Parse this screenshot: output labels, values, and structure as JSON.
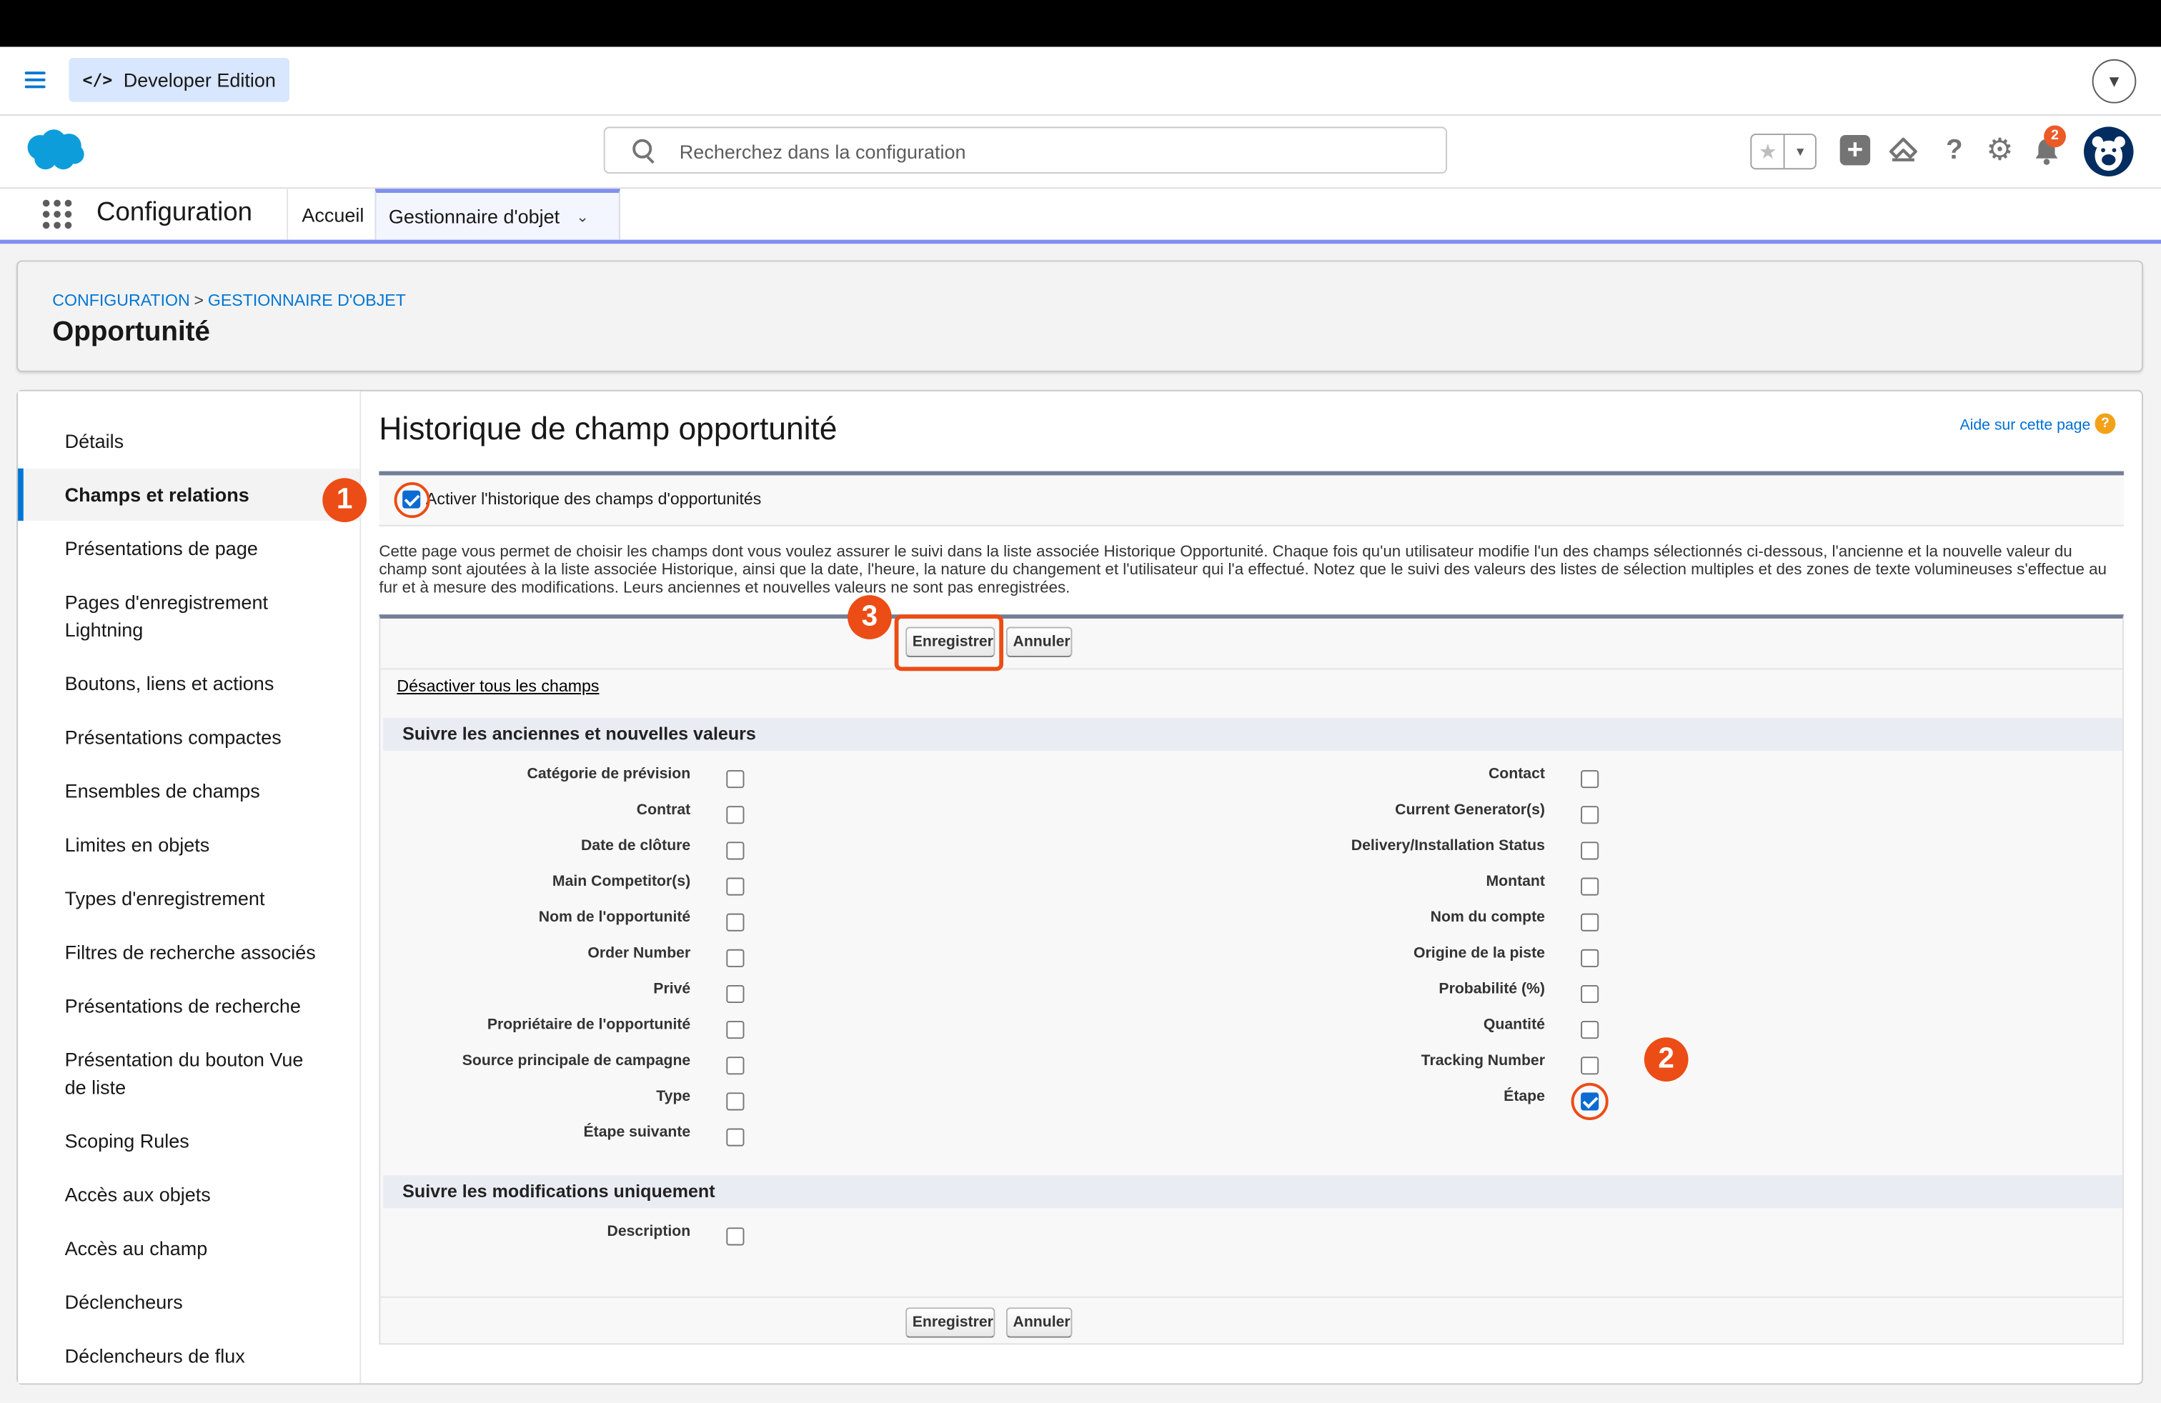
{
  "devbar": {
    "badge": "Developer Edition"
  },
  "header": {
    "search_placeholder": "Recherchez dans la configuration",
    "notification_count": "2"
  },
  "appnav": {
    "app_name": "Configuration",
    "tabs": [
      {
        "label": "Accueil"
      },
      {
        "label": "Gestionnaire d'objet"
      }
    ]
  },
  "page_header": {
    "breadcrumb": [
      "CONFIGURATION",
      "GESTIONNAIRE D'OBJET"
    ],
    "breadcrumb_sep": ">",
    "title": "Opportunité"
  },
  "sidebar": {
    "items": [
      {
        "label": "Détails"
      },
      {
        "label": "Champs et relations"
      },
      {
        "label": "Présentations de page"
      },
      {
        "label": "Pages d'enregistrement Lightning"
      },
      {
        "label": "Boutons, liens et actions"
      },
      {
        "label": "Présentations compactes"
      },
      {
        "label": "Ensembles de champs"
      },
      {
        "label": "Limites en objets"
      },
      {
        "label": "Types d'enregistrement"
      },
      {
        "label": "Filtres de recherche associés"
      },
      {
        "label": "Présentations de recherche"
      },
      {
        "label": "Présentation du bouton Vue de liste"
      },
      {
        "label": "Scoping Rules"
      },
      {
        "label": "Accès aux objets"
      },
      {
        "label": "Accès au champ"
      },
      {
        "label": "Déclencheurs"
      },
      {
        "label": "Déclencheurs de flux"
      }
    ]
  },
  "content": {
    "title": "Historique de champ opportunité",
    "help_link": "Aide sur cette page",
    "help_icon_glyph": "?",
    "enable_label": "Activer l'historique des champs d'opportunités",
    "description": "Cette page vous permet de choisir les champs dont vous voulez assurer le suivi dans la liste associée Historique Opportunité. Chaque fois qu'un utilisateur modifie l'un des champs sélectionnés ci-dessous, l'ancienne et la nouvelle valeur du champ sont ajoutées à la liste associée Historique, ainsi que la date, l'heure, la nature du changement et l'utilisateur qui l'a effectué. Notez que le suivi des valeurs des listes de sélection multiples et des zones de texte volumineuses s'effectue au fur et à mesure des modifications. Leurs anciennes et nouvelles valeurs ne sont pas enregistrées.",
    "save_label": "Enregistrer",
    "cancel_label": "Annuler",
    "disable_all_link": "Désactiver tous les champs",
    "section_track_values": "Suivre les anciennes et nouvelles valeurs",
    "section_track_changes": "Suivre les modifications uniquement",
    "left_fields": [
      {
        "label": "Catégorie de prévision",
        "checked": false
      },
      {
        "label": "Contrat",
        "checked": false
      },
      {
        "label": "Date de clôture",
        "checked": false
      },
      {
        "label": "Main Competitor(s)",
        "checked": false
      },
      {
        "label": "Nom de l'opportunité",
        "checked": false
      },
      {
        "label": "Order Number",
        "checked": false
      },
      {
        "label": "Privé",
        "checked": false
      },
      {
        "label": "Propriétaire de l'opportunité",
        "checked": false
      },
      {
        "label": "Source principale de campagne",
        "checked": false
      },
      {
        "label": "Type",
        "checked": false
      },
      {
        "label": "Étape suivante",
        "checked": false
      }
    ],
    "right_fields": [
      {
        "label": "Contact",
        "checked": false
      },
      {
        "label": "Current Generator(s)",
        "checked": false
      },
      {
        "label": "Delivery/Installation Status",
        "checked": false
      },
      {
        "label": "Montant",
        "checked": false
      },
      {
        "label": "Nom du compte",
        "checked": false
      },
      {
        "label": "Origine de la piste",
        "checked": false
      },
      {
        "label": "Probabilité (%)",
        "checked": false
      },
      {
        "label": "Quantité",
        "checked": false
      },
      {
        "label": "Tracking Number",
        "checked": false
      },
      {
        "label": "Étape",
        "checked": true
      }
    ],
    "change_fields": [
      {
        "label": "Description",
        "checked": false
      }
    ]
  },
  "annotations": {
    "markers": [
      "1",
      "2",
      "3"
    ],
    "color": "#ec4c15"
  },
  "colors": {
    "brand_blue": "#0176d3",
    "accent_nav": "#8090ef"
  }
}
